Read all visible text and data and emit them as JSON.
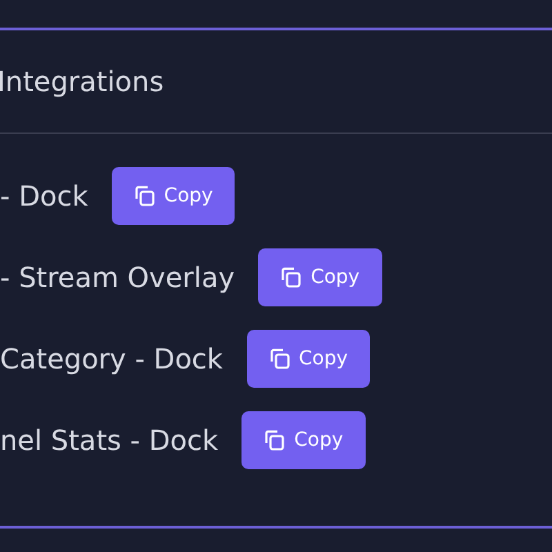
{
  "section": {
    "title": "Integrations"
  },
  "integrations": [
    {
      "name": "- Dock",
      "button": "Copy"
    },
    {
      "name": "- Stream Overlay",
      "button": "Copy"
    },
    {
      "name": "Category - Dock",
      "button": "Copy"
    },
    {
      "name": "nel Stats - Dock",
      "button": "Copy"
    }
  ]
}
